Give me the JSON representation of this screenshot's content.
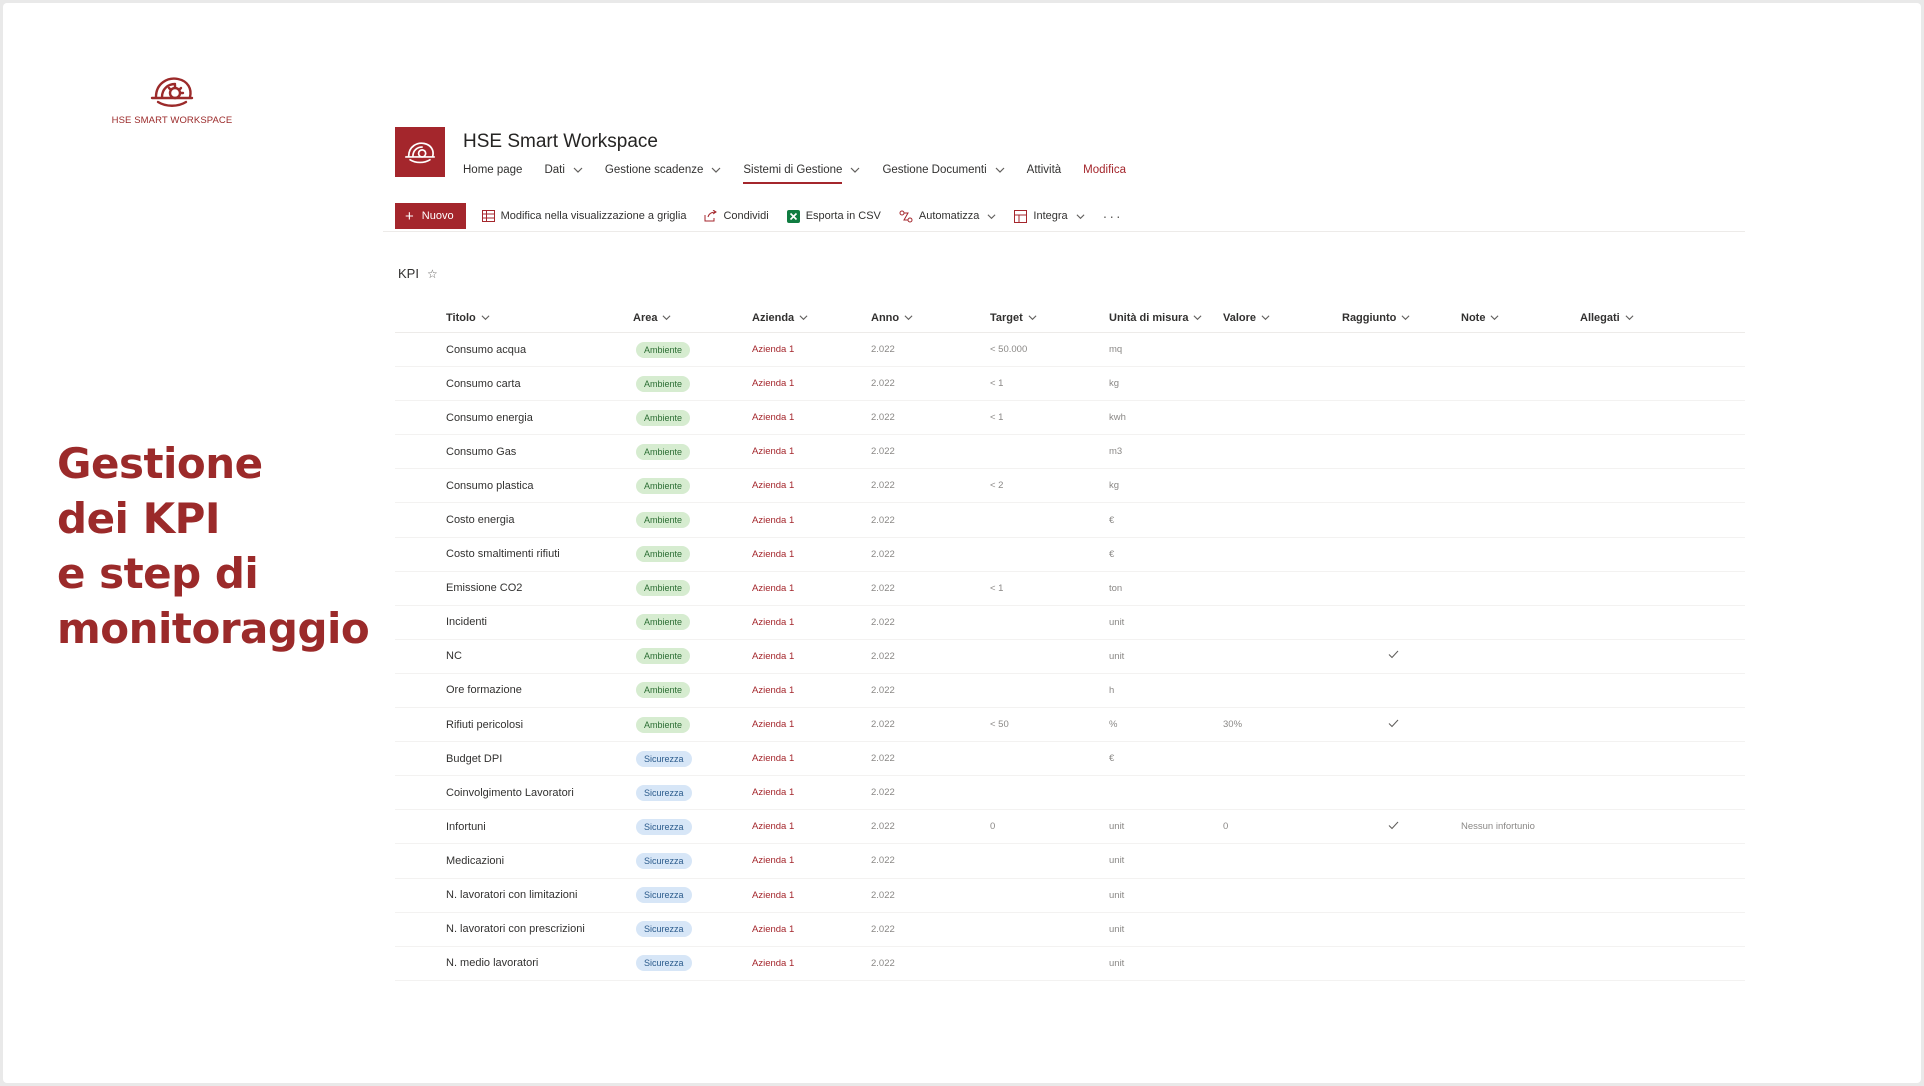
{
  "brand": {
    "text": "HSE SMART WORKSPACE"
  },
  "headline": [
    "Gestione",
    "dei KPI",
    "e step di",
    "monitoraggio"
  ],
  "site": {
    "title": "HSE Smart Workspace",
    "nav": [
      {
        "label": "Home page",
        "chevron": false
      },
      {
        "label": "Dati",
        "chevron": true
      },
      {
        "label": "Gestione scadenze",
        "chevron": true
      },
      {
        "label": "Sistemi di Gestione",
        "chevron": true,
        "active": true
      },
      {
        "label": "Gestione Documenti",
        "chevron": true
      },
      {
        "label": "Attività",
        "chevron": false
      },
      {
        "label": "Modifica",
        "chevron": false,
        "edit": true
      }
    ]
  },
  "toolbar": {
    "new_label": "Nuovo",
    "grid_label": "Modifica nella visualizzazione a griglia",
    "share_label": "Condividi",
    "export_label": "Esporta in CSV",
    "automate_label": "Automatizza",
    "integrate_label": "Integra",
    "more_label": "···"
  },
  "list": {
    "title": "KPI",
    "columns": [
      "Titolo",
      "Area",
      "Azienda",
      "Anno",
      "Target",
      "Unità di misura",
      "Valore",
      "Raggiunto",
      "Note",
      "Allegati"
    ],
    "rows": [
      {
        "titolo": "Consumo acqua",
        "area": "Ambiente",
        "azienda": "Azienda 1",
        "anno": "2.022",
        "target": "< 50.000",
        "unita": "mq",
        "valore": "",
        "raggiunto": false,
        "note": ""
      },
      {
        "titolo": "Consumo carta",
        "area": "Ambiente",
        "azienda": "Azienda 1",
        "anno": "2.022",
        "target": "< 1",
        "unita": "kg",
        "valore": "",
        "raggiunto": false,
        "note": ""
      },
      {
        "titolo": "Consumo energia",
        "area": "Ambiente",
        "azienda": "Azienda 1",
        "anno": "2.022",
        "target": "< 1",
        "unita": "kwh",
        "valore": "",
        "raggiunto": false,
        "note": ""
      },
      {
        "titolo": "Consumo Gas",
        "area": "Ambiente",
        "azienda": "Azienda 1",
        "anno": "2.022",
        "target": "",
        "unita": "m3",
        "valore": "",
        "raggiunto": false,
        "note": ""
      },
      {
        "titolo": "Consumo plastica",
        "area": "Ambiente",
        "azienda": "Azienda 1",
        "anno": "2.022",
        "target": "< 2",
        "unita": "kg",
        "valore": "",
        "raggiunto": false,
        "note": ""
      },
      {
        "titolo": "Costo energia",
        "area": "Ambiente",
        "azienda": "Azienda 1",
        "anno": "2.022",
        "target": "",
        "unita": "€",
        "valore": "",
        "raggiunto": false,
        "note": ""
      },
      {
        "titolo": "Costo smaltimenti rifiuti",
        "area": "Ambiente",
        "azienda": "Azienda 1",
        "anno": "2.022",
        "target": "",
        "unita": "€",
        "valore": "",
        "raggiunto": false,
        "note": ""
      },
      {
        "titolo": "Emissione CO2",
        "area": "Ambiente",
        "azienda": "Azienda 1",
        "anno": "2.022",
        "target": "< 1",
        "unita": "ton",
        "valore": "",
        "raggiunto": false,
        "note": ""
      },
      {
        "titolo": "Incidenti",
        "area": "Ambiente",
        "azienda": "Azienda 1",
        "anno": "2.022",
        "target": "",
        "unita": "unit",
        "valore": "",
        "raggiunto": false,
        "note": ""
      },
      {
        "titolo": "NC",
        "area": "Ambiente",
        "azienda": "Azienda 1",
        "anno": "2.022",
        "target": "",
        "unita": "unit",
        "valore": "",
        "raggiunto": true,
        "note": ""
      },
      {
        "titolo": "Ore formazione",
        "area": "Ambiente",
        "azienda": "Azienda 1",
        "anno": "2.022",
        "target": "",
        "unita": "h",
        "valore": "",
        "raggiunto": false,
        "note": ""
      },
      {
        "titolo": "Rifiuti pericolosi",
        "area": "Ambiente",
        "azienda": "Azienda 1",
        "anno": "2.022",
        "target": "< 50",
        "unita": "%",
        "valore": "30%",
        "raggiunto": true,
        "note": ""
      },
      {
        "titolo": "Budget DPI",
        "area": "Sicurezza",
        "azienda": "Azienda 1",
        "anno": "2.022",
        "target": "",
        "unita": "€",
        "valore": "",
        "raggiunto": false,
        "note": ""
      },
      {
        "titolo": "Coinvolgimento Lavoratori",
        "area": "Sicurezza",
        "azienda": "Azienda 1",
        "anno": "2.022",
        "target": "",
        "unita": "",
        "valore": "",
        "raggiunto": false,
        "note": ""
      },
      {
        "titolo": "Infortuni",
        "area": "Sicurezza",
        "azienda": "Azienda 1",
        "anno": "2.022",
        "target": "0",
        "unita": "unit",
        "valore": "0",
        "raggiunto": true,
        "note": "Nessun infortunio"
      },
      {
        "titolo": "Medicazioni",
        "area": "Sicurezza",
        "azienda": "Azienda 1",
        "anno": "2.022",
        "target": "",
        "unita": "unit",
        "valore": "",
        "raggiunto": false,
        "note": ""
      },
      {
        "titolo": "N. lavoratori con limitazioni",
        "area": "Sicurezza",
        "azienda": "Azienda 1",
        "anno": "2.022",
        "target": "",
        "unita": "unit",
        "valore": "",
        "raggiunto": false,
        "note": ""
      },
      {
        "titolo": "N. lavoratori con prescrizioni",
        "area": "Sicurezza",
        "azienda": "Azienda 1",
        "anno": "2.022",
        "target": "",
        "unita": "unit",
        "valore": "",
        "raggiunto": false,
        "note": ""
      },
      {
        "titolo": "N. medio lavoratori",
        "area": "Sicurezza",
        "azienda": "Azienda 1",
        "anno": "2.022",
        "target": "",
        "unita": "unit",
        "valore": "",
        "raggiunto": false,
        "note": ""
      }
    ]
  },
  "colors": {
    "brand": "#a4262c",
    "headline": "#9b2a2a",
    "ambiente_bg": "#d6ecd0",
    "sicurezza_bg": "#d7e6f7"
  },
  "icons": {
    "logo": "helmet-gear-icon",
    "new": "plus-icon",
    "grid": "grid-icon",
    "share": "share-icon",
    "export": "excel-icon",
    "automate": "flow-icon",
    "integrate": "app-icon",
    "favorite": "star-icon",
    "reached": "checkmark-icon"
  }
}
